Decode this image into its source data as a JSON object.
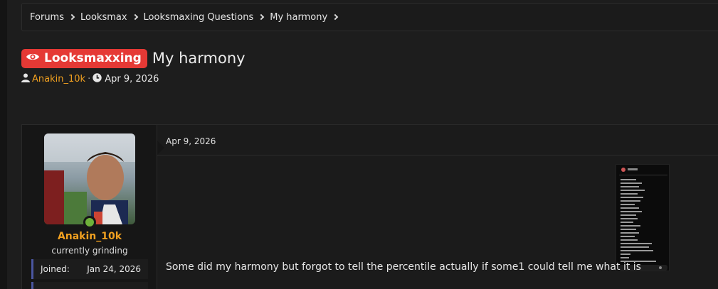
{
  "breadcrumb": [
    {
      "label": "Forums"
    },
    {
      "label": "Looksmax"
    },
    {
      "label": "Looksmaxing Questions"
    },
    {
      "label": "My harmony"
    }
  ],
  "thread": {
    "prefix": "Looksmaxxing",
    "title": "My harmony",
    "author": "Anakin_10k",
    "separator": "·",
    "date": "Apr 9, 2026"
  },
  "post": {
    "date": "Apr 9, 2026",
    "text": "Some did my harmony but forgot to tell the percentile actually if some1 could tell me what it is"
  },
  "user": {
    "name": "Anakin_10k",
    "title": "currently grinding",
    "stats": [
      {
        "label": "Joined:",
        "value": "Jan 24, 2026"
      }
    ]
  },
  "colors": {
    "prefix_bg": "#e53935",
    "username": "#f0a020",
    "online": "#6fb23a",
    "stat_border": "#4a56a0"
  },
  "icons": [
    "chevron-right-icon",
    "eye-icon",
    "user-icon",
    "clock-icon"
  ]
}
